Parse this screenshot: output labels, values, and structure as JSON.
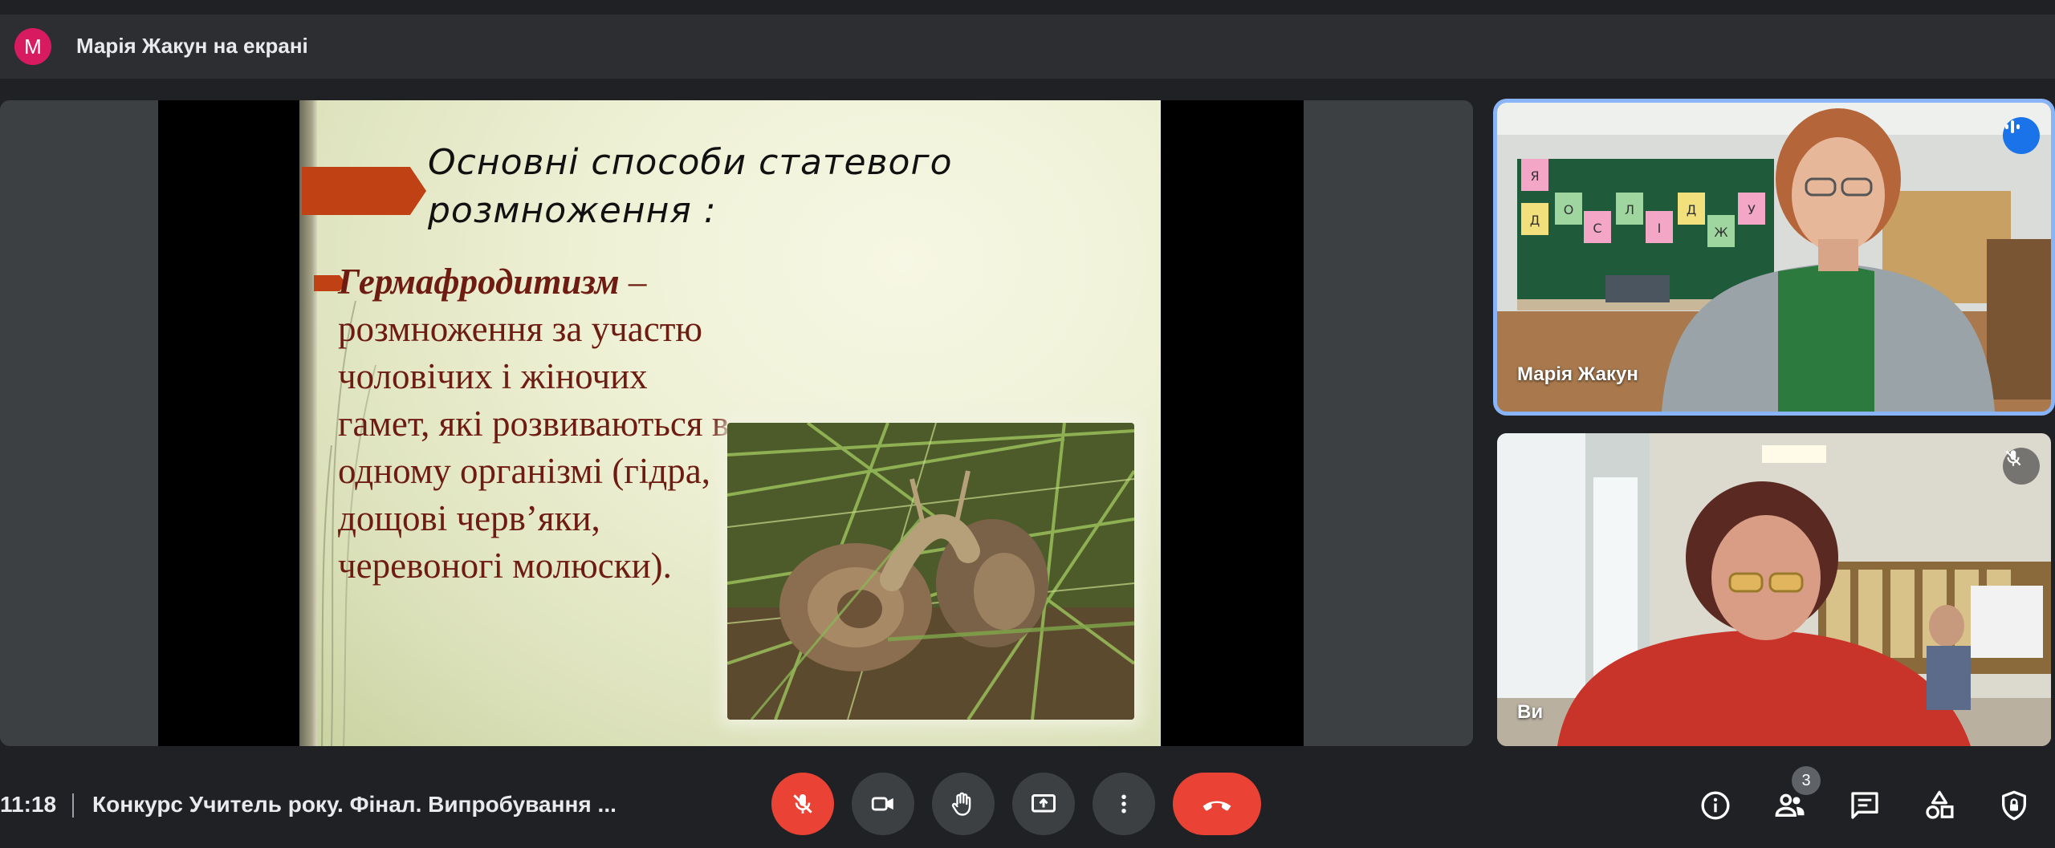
{
  "presenter": {
    "avatar_letter": "М",
    "text": "Марія Жакун на екрані",
    "avatar_color": "#d81b60"
  },
  "slide": {
    "title": "Основні способи статевого\nрозмноження :",
    "term": "Гермафродитизм",
    "body_rest": " – розмноження за участю чоловічих і жіночих гамет, які розвиваються в одному організмі (гідра, дощові черв’яки, черевоногі молюски).",
    "accent_color": "#bf4114",
    "body_color": "#6e1c12"
  },
  "participants": [
    {
      "name": "Марія Жакун",
      "state": "speaking",
      "icon": "audio-level-icon"
    },
    {
      "name": "Ви",
      "state": "muted",
      "icon": "mic-off-icon"
    }
  ],
  "classroom_letters": [
    "Я",
    "Д",
    "О",
    "С",
    "Л",
    "І",
    "Д",
    "Ж",
    "У"
  ],
  "bottom_bar": {
    "time": "11:18",
    "meeting_title": "Конкурс Учитель року. Фінал. Випробування ...",
    "controls": [
      "mic-off-icon",
      "camera-icon",
      "raise-hand-icon",
      "present-screen-icon",
      "more-options-icon",
      "end-call-icon"
    ],
    "people_count": "3",
    "right_icons": [
      "info-icon",
      "people-icon",
      "chat-icon",
      "activities-icon",
      "host-controls-icon"
    ],
    "end_call_color": "#ea4335",
    "active_tile_border": "#8ab4f8"
  }
}
